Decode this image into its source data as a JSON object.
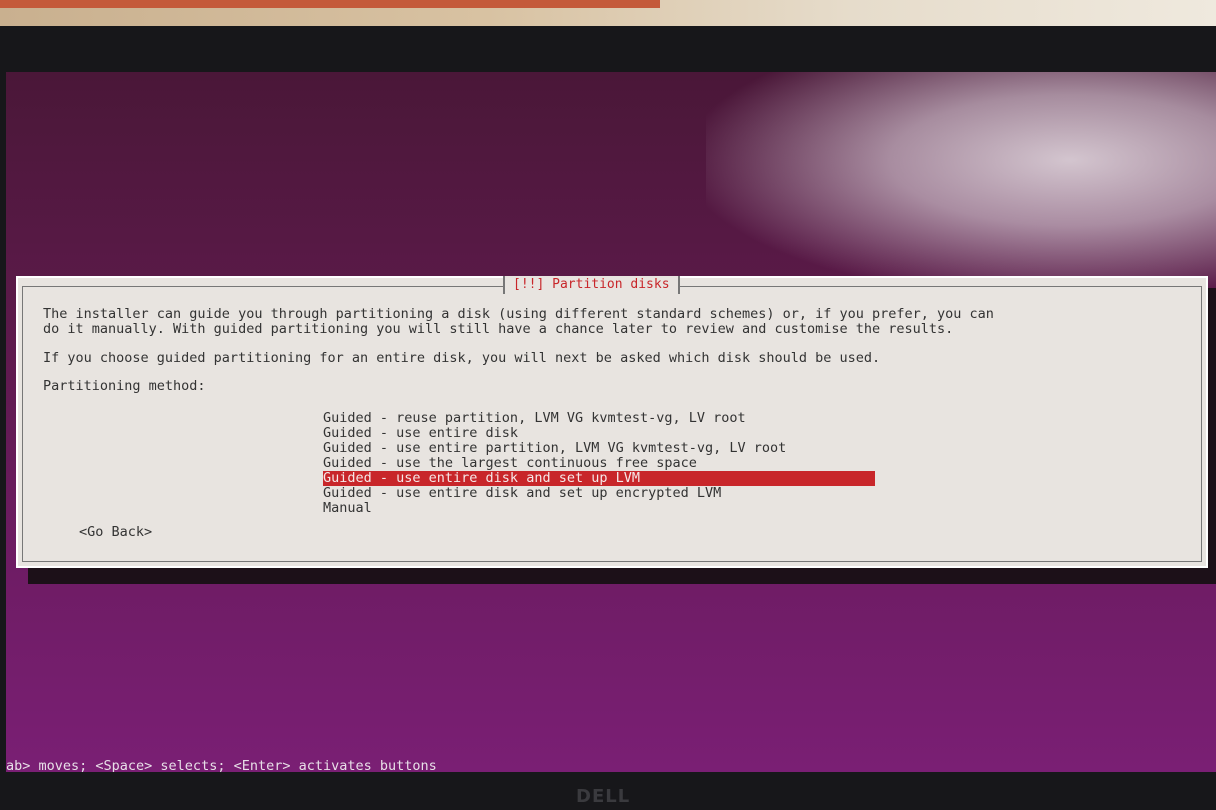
{
  "dialog": {
    "title": "[!!] Partition disks",
    "description_line1": "The installer can guide you through partitioning a disk (using different standard schemes) or, if you prefer, you can",
    "description_line2": "do it manually. With guided partitioning you will still have a chance later to review and customise the results.",
    "description_line3": "If you choose guided partitioning for an entire disk, you will next be asked which disk should be used.",
    "prompt": "Partitioning method:",
    "options": [
      "Guided - reuse partition, LVM VG kvmtest-vg, LV root",
      "Guided - use entire disk",
      "Guided - use entire partition, LVM VG kvmtest-vg, LV root",
      "Guided - use the largest continuous free space",
      "Guided - use entire disk and set up LVM",
      "Guided - use entire disk and set up encrypted LVM",
      "Manual"
    ],
    "selected_index": 4,
    "go_back_label": "<Go Back>"
  },
  "help_bar": "ab> moves; <Space> selects; <Enter> activates buttons",
  "monitor_brand": "DELL",
  "colors": {
    "accent": "#c8262a",
    "dialog_bg": "#e8e4e0",
    "screen_bg": "#6e1c64"
  }
}
